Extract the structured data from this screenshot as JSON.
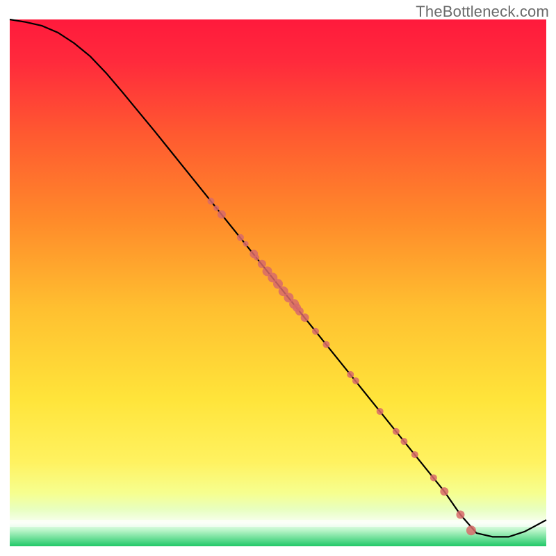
{
  "watermark": "TheBottleneck.com",
  "chart_data": {
    "type": "line",
    "title": "",
    "xlabel": "",
    "ylabel": "",
    "xlim": [
      0,
      100
    ],
    "ylim": [
      0,
      100
    ],
    "x": [
      0,
      3,
      6,
      9,
      12,
      15,
      18,
      21,
      24,
      27,
      30,
      33,
      36,
      39,
      42,
      45,
      48,
      51,
      54,
      57,
      60,
      63,
      66,
      69,
      72,
      75,
      78,
      81,
      84,
      87,
      90,
      93,
      96,
      100
    ],
    "y": [
      100,
      99.5,
      98.8,
      97.5,
      95.5,
      93.0,
      89.8,
      86.2,
      82.5,
      78.8,
      75.0,
      71.2,
      67.4,
      63.6,
      59.8,
      56.0,
      52.2,
      48.4,
      44.6,
      40.8,
      37.0,
      33.2,
      29.4,
      25.6,
      21.8,
      18.0,
      14.2,
      10.4,
      6.0,
      2.5,
      1.8,
      1.8,
      2.8,
      5.0
    ],
    "markers": {
      "x": [
        37.5,
        38.5,
        39.5,
        43.0,
        44.0,
        45.5,
        46.0,
        47.0,
        48.0,
        49.0,
        50.0,
        51.0,
        52.0,
        53.0,
        53.5,
        54.0,
        55.0,
        57.0,
        59.0,
        63.5,
        64.5,
        69.0,
        72.0,
        73.5,
        75.5,
        79.0,
        81.0,
        84.0,
        86.0
      ],
      "y": [
        65.5,
        64.2,
        63.0,
        58.6,
        57.4,
        55.5,
        54.8,
        53.6,
        52.2,
        51.0,
        49.8,
        48.4,
        47.2,
        46.0,
        45.3,
        44.6,
        43.4,
        40.8,
        38.3,
        32.6,
        31.4,
        25.6,
        21.8,
        19.9,
        17.4,
        13.0,
        10.4,
        6.0,
        3.0
      ],
      "radius": [
        5,
        4,
        6,
        5,
        4,
        6,
        4,
        6,
        7,
        7,
        7,
        7,
        7,
        7,
        6,
        6,
        6,
        5,
        5,
        5,
        5,
        5,
        5,
        5,
        5,
        5,
        6,
        6,
        7
      ]
    },
    "gradient": {
      "top_color": "#ff2040",
      "mid_color": "#ffe040",
      "bottom_color": "#30d070",
      "white_band_y": [
        2,
        7
      ],
      "green_band_y": [
        0,
        2
      ]
    }
  }
}
